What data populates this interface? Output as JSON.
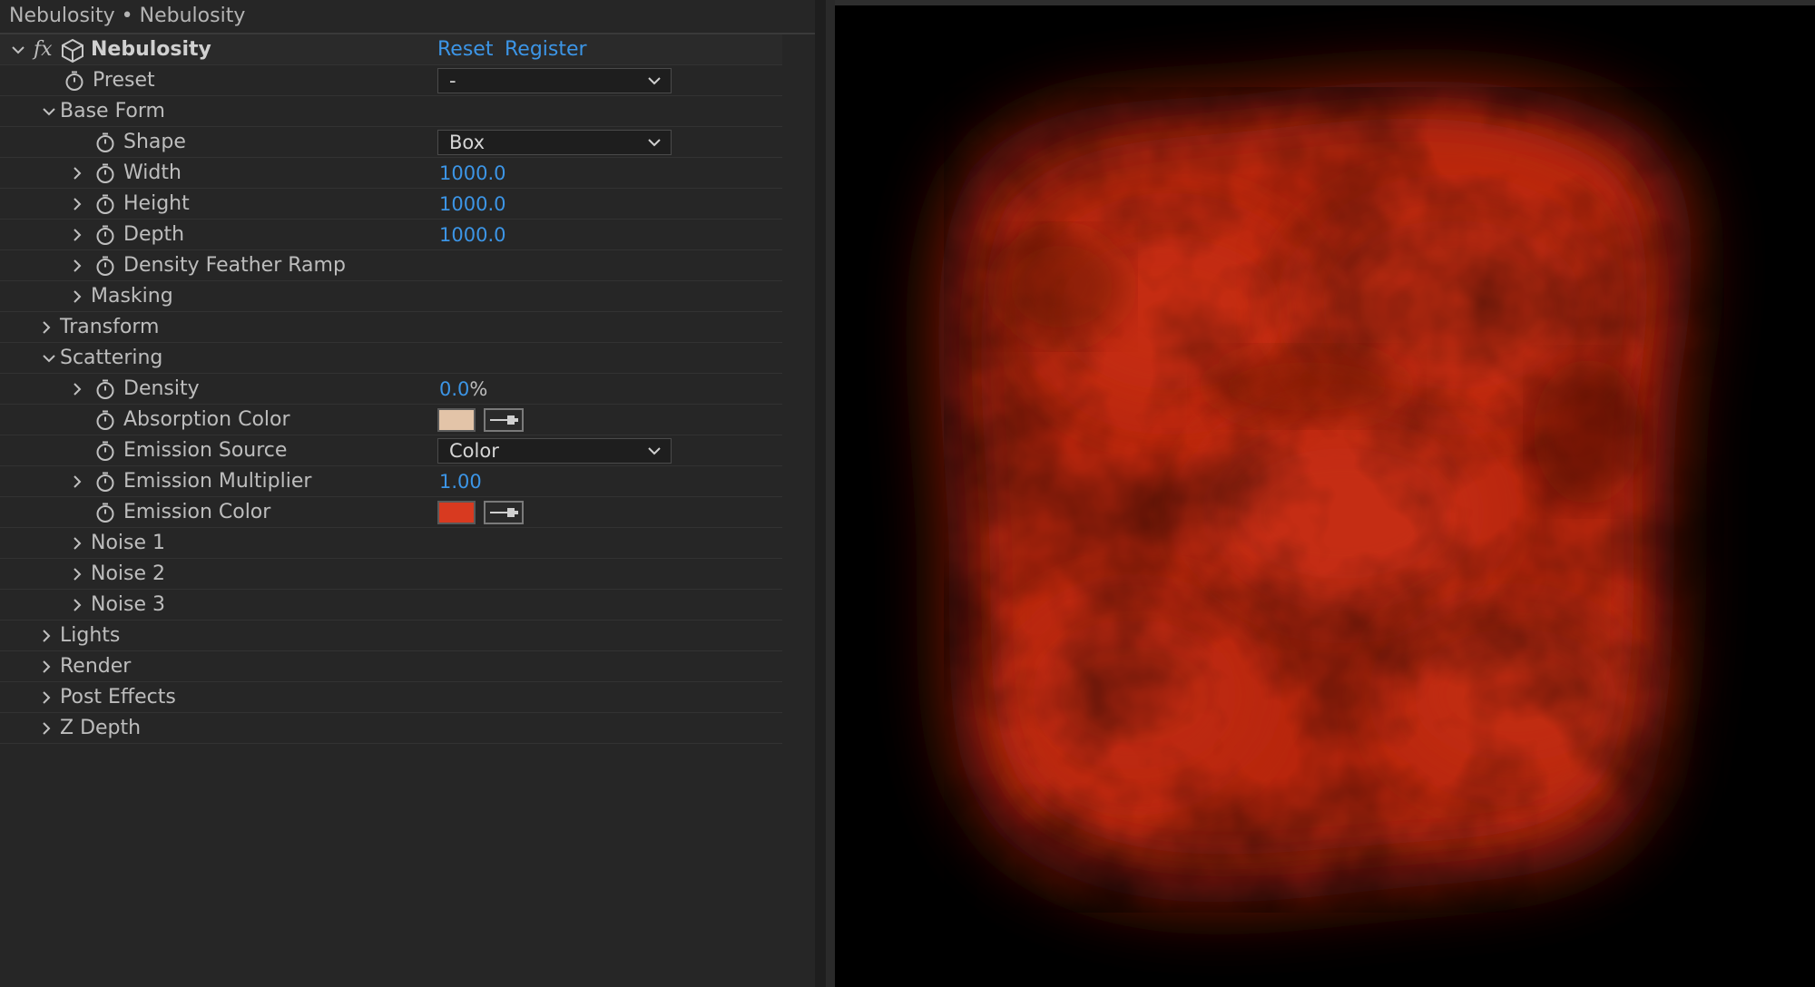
{
  "panel": {
    "title": "Nebulosity • Nebulosity",
    "effect_name": "Nebulosity",
    "fx_label": "fx",
    "reset_label": "Reset",
    "register_label": "Register"
  },
  "rows": {
    "preset": {
      "label": "Preset",
      "value": "-"
    },
    "base_form": {
      "label": "Base Form"
    },
    "shape": {
      "label": "Shape",
      "value": "Box"
    },
    "width": {
      "label": "Width",
      "value": "1000.0"
    },
    "height": {
      "label": "Height",
      "value": "1000.0"
    },
    "depth": {
      "label": "Depth",
      "value": "1000.0"
    },
    "density_feather_ramp": {
      "label": "Density Feather Ramp"
    },
    "masking": {
      "label": "Masking"
    },
    "transform": {
      "label": "Transform"
    },
    "scattering": {
      "label": "Scattering"
    },
    "density": {
      "label": "Density",
      "value": "0.0",
      "unit": "%"
    },
    "absorption_color": {
      "label": "Absorption Color",
      "color": "#e3c4a8"
    },
    "emission_source": {
      "label": "Emission Source",
      "value": "Color"
    },
    "emission_multiplier": {
      "label": "Emission Multiplier",
      "value": "1.00"
    },
    "emission_color": {
      "label": "Emission Color",
      "color": "#d83a20"
    },
    "noise_1": {
      "label": "Noise 1"
    },
    "noise_2": {
      "label": "Noise 2"
    },
    "noise_3": {
      "label": "Noise 3"
    },
    "lights": {
      "label": "Lights"
    },
    "render": {
      "label": "Render"
    },
    "post_effects": {
      "label": "Post Effects"
    },
    "z_depth": {
      "label": "Z Depth"
    }
  },
  "colors": {
    "accent": "#3c95e6",
    "panel_bg": "#262626",
    "cloud": "#c22a0c"
  },
  "icons": {
    "expand": "chevron-down-icon",
    "collapse": "chevron-right-icon",
    "stopwatch": "stopwatch-icon",
    "effect": "cube-icon",
    "eyedropper": "eyedropper-icon"
  }
}
